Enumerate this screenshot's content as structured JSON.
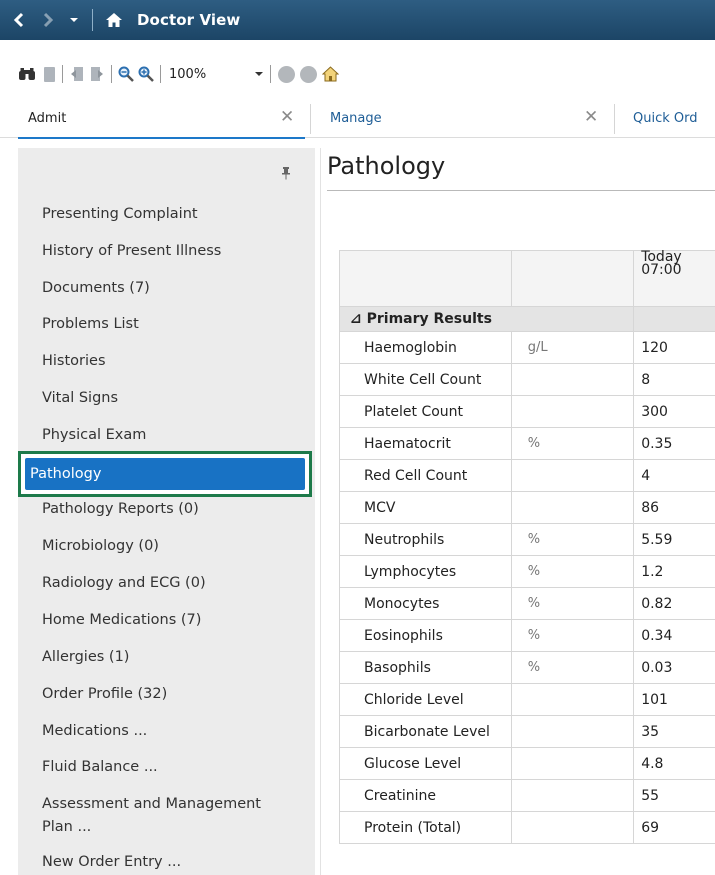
{
  "window": {
    "title": "Doctor View"
  },
  "toolbar": {
    "zoom": "100%"
  },
  "tabs": [
    {
      "label": "Admit"
    },
    {
      "label": "Manage"
    },
    {
      "label": "Quick Ord"
    }
  ],
  "nav": {
    "items": [
      "Presenting Complaint",
      "History of Present Illness",
      "Documents (7)",
      "Problems List",
      "Histories",
      "Vital Signs",
      "Physical Exam",
      "Pathology Reports (0)",
      "Microbiology (0)",
      "Radiology and ECG (0)",
      "Home Medications (7)",
      "Allergies (1)",
      "Order Profile (32)",
      "Medications ...",
      "Fluid Balance ...",
      "Assessment and Management",
      "Plan ...",
      "New Order Entry ..."
    ],
    "active": "Pathology"
  },
  "content": {
    "title": "Pathology",
    "column_header": {
      "day": "Today",
      "time": "07:00"
    },
    "section": "Primary Results",
    "rows": [
      {
        "name": "Haemoglobin",
        "unit": "g/L",
        "value": "120"
      },
      {
        "name": "White Cell Count",
        "unit": "",
        "value": "8"
      },
      {
        "name": "Platelet Count",
        "unit": "",
        "value": "300"
      },
      {
        "name": "Haematocrit",
        "unit": "%",
        "value": "0.35"
      },
      {
        "name": "Red Cell Count",
        "unit": "",
        "value": "4"
      },
      {
        "name": "MCV",
        "unit": "",
        "value": "86"
      },
      {
        "name": "Neutrophils",
        "unit": "%",
        "value": "5.59"
      },
      {
        "name": "Lymphocytes",
        "unit": "%",
        "value": "1.2"
      },
      {
        "name": "Monocytes",
        "unit": "%",
        "value": "0.82"
      },
      {
        "name": "Eosinophils",
        "unit": "%",
        "value": "0.34"
      },
      {
        "name": "Basophils",
        "unit": "%",
        "value": "0.03"
      },
      {
        "name": "Chloride Level",
        "unit": "",
        "value": "101"
      },
      {
        "name": "Bicarbonate Level",
        "unit": "",
        "value": "35"
      },
      {
        "name": "Glucose Level",
        "unit": "",
        "value": "4.8"
      },
      {
        "name": "Creatinine",
        "unit": "",
        "value": "55"
      },
      {
        "name": "Protein (Total)",
        "unit": "",
        "value": "69"
      }
    ]
  },
  "colors": {
    "titlebar": "#1c4566",
    "active_nav": "#1872c4",
    "active_nav_outline": "#1d7a4a",
    "tab_link": "#1e5d96"
  }
}
